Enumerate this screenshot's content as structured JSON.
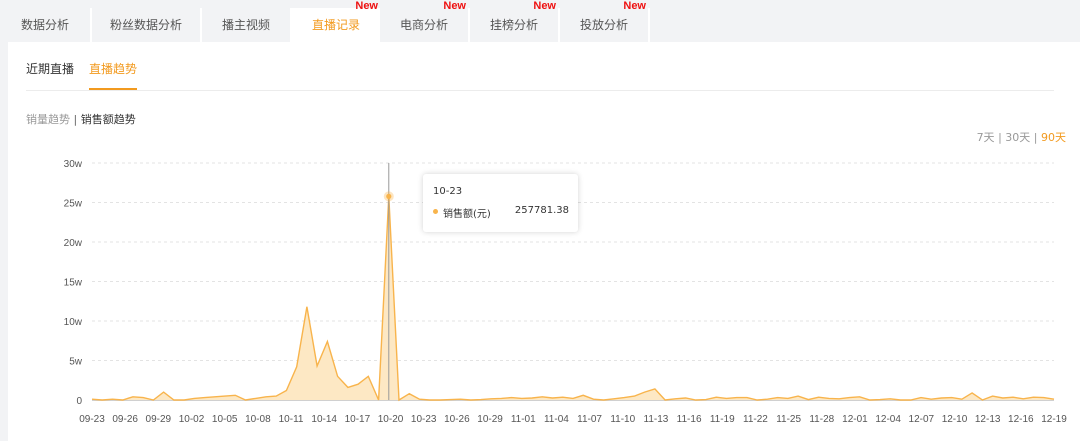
{
  "nav": {
    "tabs": [
      {
        "label": "数据分析",
        "badge": ""
      },
      {
        "label": "粉丝数据分析",
        "badge": ""
      },
      {
        "label": "播主视频",
        "badge": ""
      },
      {
        "label": "直播记录",
        "badge": "New",
        "active": true
      },
      {
        "label": "电商分析",
        "badge": "New"
      },
      {
        "label": "挂榜分析",
        "badge": "New"
      },
      {
        "label": "投放分析",
        "badge": "New"
      }
    ]
  },
  "subtabs": {
    "recent": "近期直播",
    "trend": "直播趋势"
  },
  "metric_switch": {
    "sales_volume": "销量趋势",
    "separator": "|",
    "sales_amount": "销售额趋势"
  },
  "range_switch": {
    "d7": "7天",
    "sep1": "|",
    "d30": "30天",
    "sep2": "|",
    "d90": "90天"
  },
  "tooltip": {
    "date": "10-23",
    "label": "销售额(元)",
    "value": "257781.38"
  },
  "colors": {
    "accent": "#f29a1f",
    "series_line": "#f8b44c",
    "series_fill": "#fde8c4",
    "new_badge": "#ee1111"
  },
  "chart_data": {
    "type": "area",
    "ylabels": [
      "0",
      "5w",
      "10w",
      "15w",
      "20w",
      "25w",
      "30w"
    ],
    "ylim": [
      0,
      300000
    ],
    "xlabels": [
      "09-23",
      "09-26",
      "09-29",
      "10-02",
      "10-05",
      "10-08",
      "10-11",
      "10-14",
      "10-17",
      "10-20",
      "10-23",
      "10-26",
      "10-29",
      "11-01",
      "11-04",
      "11-07",
      "11-10",
      "11-13",
      "11-16",
      "11-19",
      "11-22",
      "11-25",
      "11-28",
      "12-01",
      "12-04",
      "12-07",
      "12-10",
      "12-13",
      "12-16",
      "12-19"
    ],
    "series": [
      {
        "values": [
          1000,
          0,
          1000,
          0,
          4000,
          3000,
          0,
          10000,
          0,
          0,
          2000,
          3000,
          4000,
          5000,
          6000,
          0,
          2000,
          4000,
          5000,
          12000,
          42000,
          118000,
          43000,
          74000,
          30000,
          16000,
          20000,
          30000,
          0,
          257781.38,
          0,
          8000,
          1000,
          0,
          0,
          500,
          1000,
          0,
          500,
          1500,
          2000,
          3000,
          2000,
          2500,
          4000,
          2500,
          3500,
          2000,
          6000,
          1000,
          0,
          1500,
          3000,
          5000,
          10000,
          14000,
          0,
          1500,
          2500,
          0,
          500,
          3500,
          2000,
          3000,
          3000,
          0,
          1000,
          3000,
          2000,
          5000,
          500,
          3500,
          2000,
          1500,
          3000,
          4000,
          0,
          500,
          1500,
          0,
          0,
          3000,
          1000,
          2500,
          3000,
          1000,
          9000,
          0,
          5000,
          2500,
          3500,
          1500,
          3500,
          3000,
          1000
        ]
      }
    ]
  }
}
